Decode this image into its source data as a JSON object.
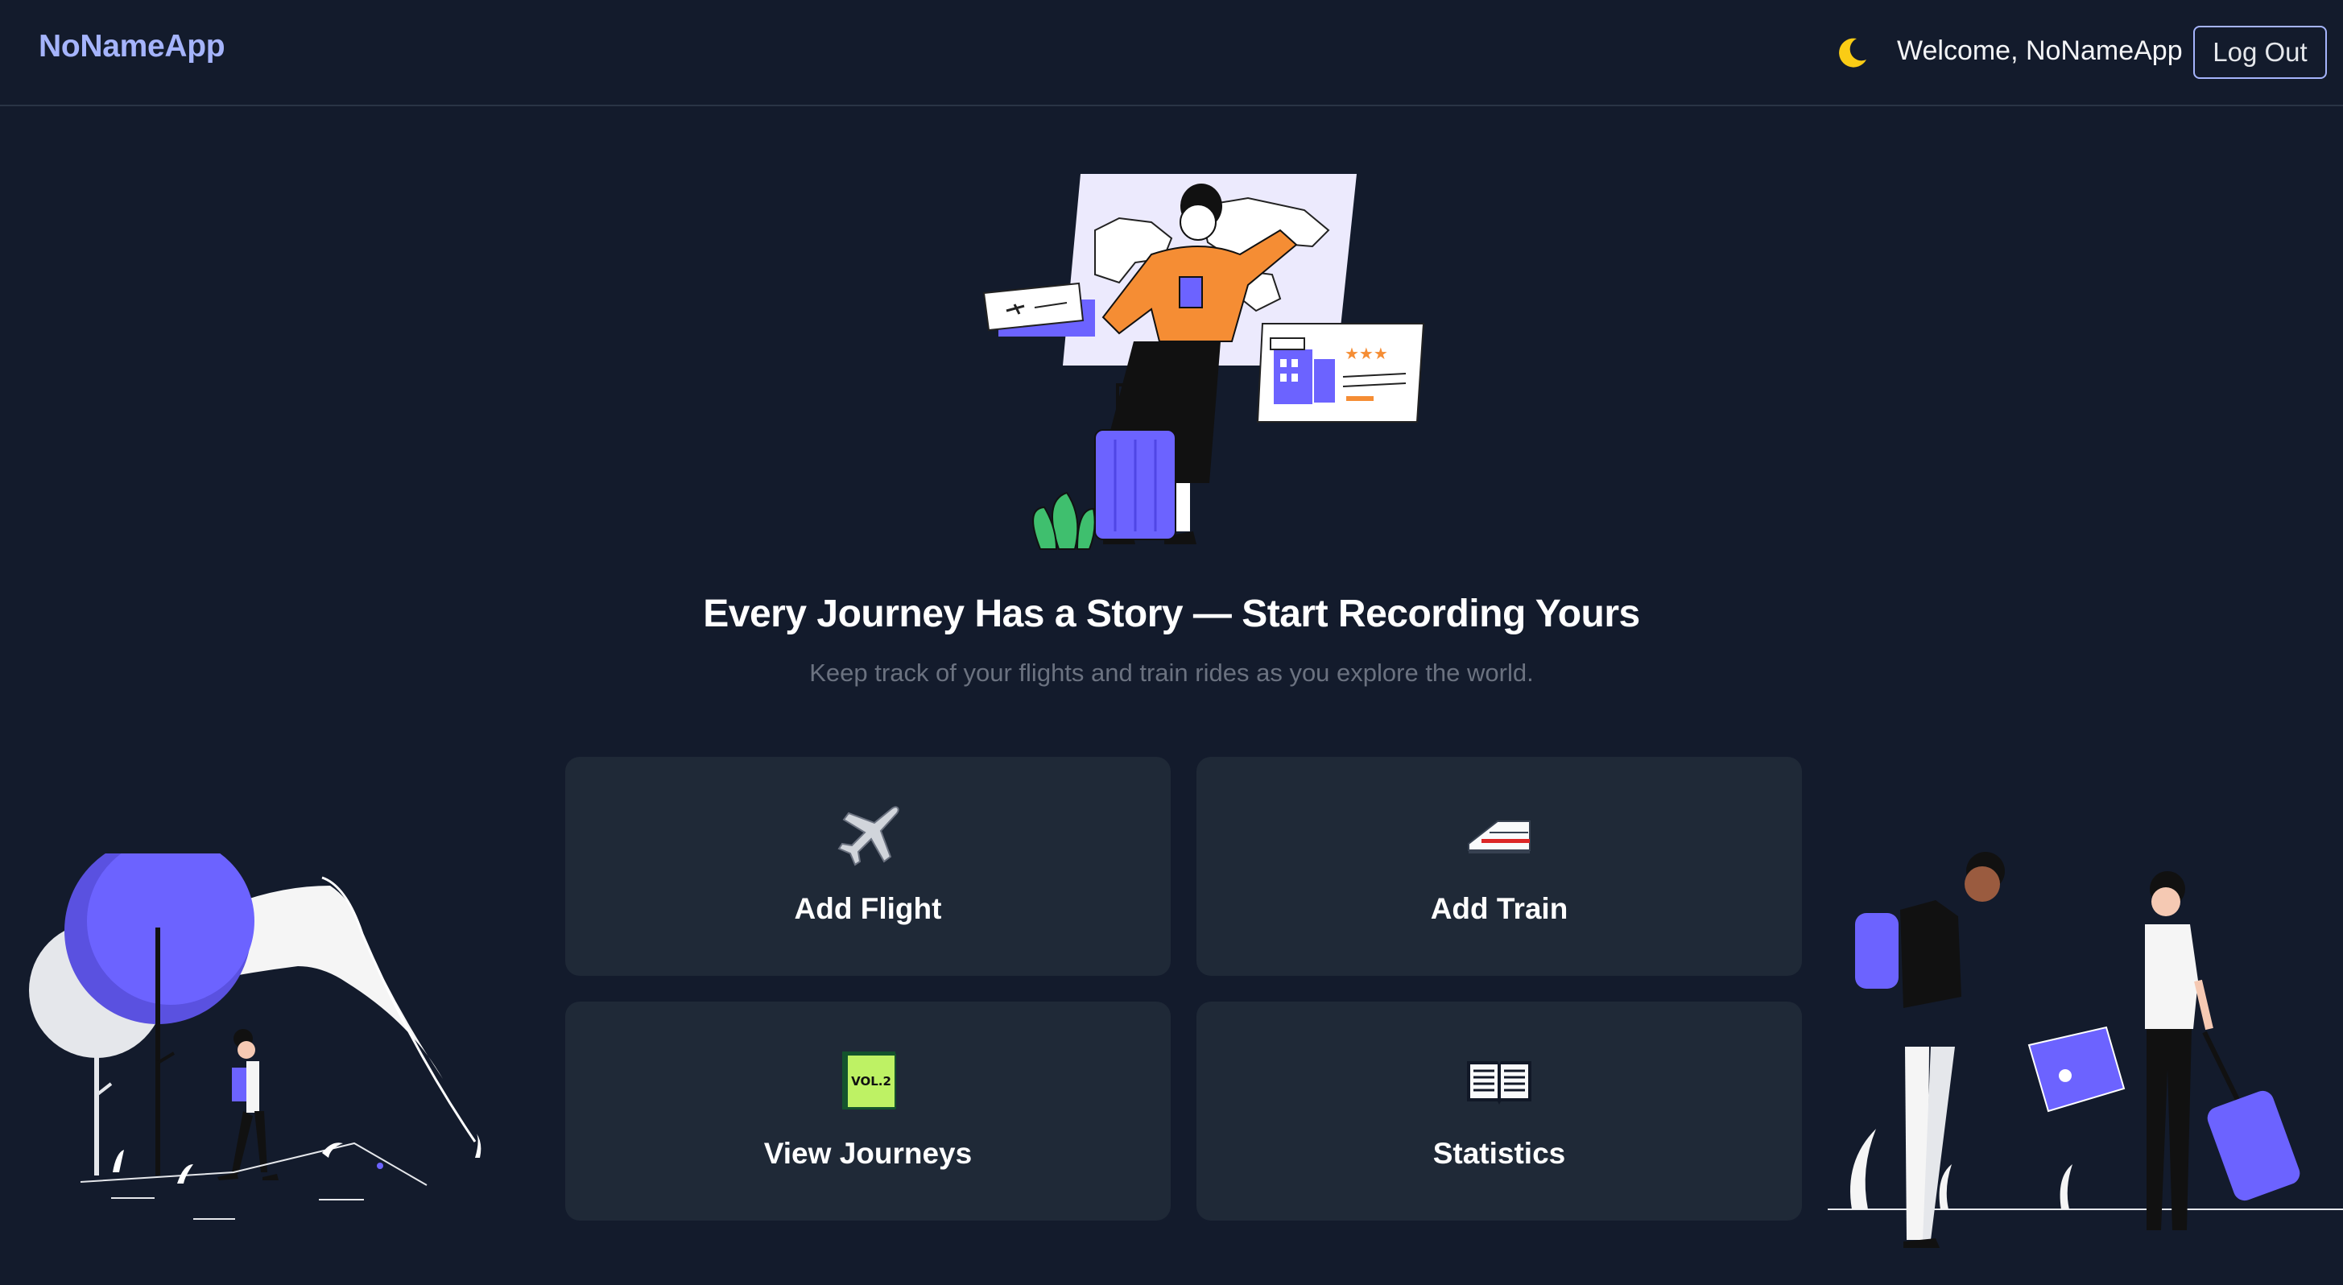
{
  "header": {
    "brand": "NoNameApp",
    "theme_toggle_icon": "moon-icon",
    "welcome_text": "Welcome, NoNameApp",
    "logout_label": "Log Out"
  },
  "hero": {
    "title": "Every Journey Has a Story — Start Recording Yours",
    "subtitle": "Keep track of your flights and train rides as you explore the world."
  },
  "cards": [
    {
      "label": "Add Flight",
      "icon": "airplane-icon"
    },
    {
      "label": "Add Train",
      "icon": "train-icon"
    },
    {
      "label": "View Journeys",
      "icon": "book-icon",
      "icon_text": "VOL.2"
    },
    {
      "label": "Statistics",
      "icon": "open-book-icon"
    }
  ],
  "colors": {
    "background": "#131b2c",
    "card": "#1f2937",
    "brand": "#a5b4fc",
    "accent_purple": "#6c63ff",
    "accent_orange": "#f58d34"
  }
}
